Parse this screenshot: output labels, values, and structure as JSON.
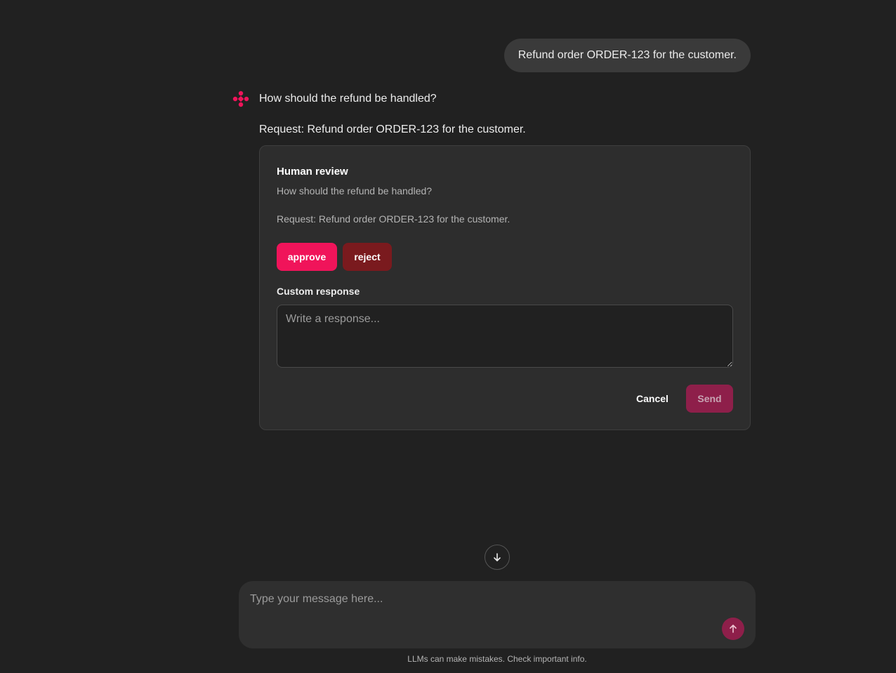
{
  "conversation": {
    "user_message": "Refund order ORDER-123 for the customer.",
    "assistant": {
      "question": "How should the refund be handled?",
      "request": "Request: Refund order ORDER-123 for the customer."
    }
  },
  "review_card": {
    "title": "Human review",
    "question": "How should the refund be handled?",
    "request": "Request: Refund order ORDER-123 for the customer.",
    "approve_label": "approve",
    "reject_label": "reject",
    "custom_label": "Custom response",
    "custom_placeholder": "Write a response...",
    "cancel_label": "Cancel",
    "send_label": "Send"
  },
  "composer": {
    "placeholder": "Type your message here..."
  },
  "footer": {
    "disclaimer": "LLMs can make mistakes. Check important info."
  },
  "colors": {
    "accent": "#f0145a",
    "reject": "#7a1a1e",
    "send_disabled": "#8e1f4a",
    "background": "#212121"
  },
  "icons": {
    "assistant": "assistant-logo-icon",
    "scroll": "arrow-down-icon",
    "send": "arrow-up-icon"
  }
}
